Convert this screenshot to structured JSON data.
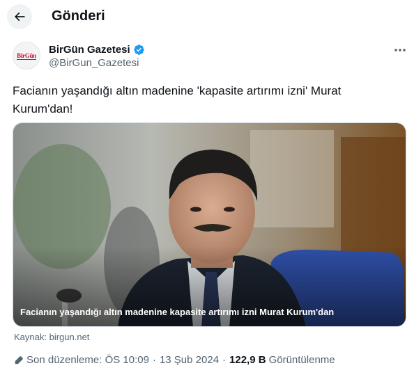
{
  "header": {
    "title": "Gönderi"
  },
  "author": {
    "avatar_text": "BirGün",
    "name": "BirGün Gazetesi",
    "handle": "@BirGun_Gazetesi"
  },
  "tweet": {
    "text": "Facianın yaşandığı altın madenine 'kapasite artırımı izni' Murat Kurum'dan!",
    "media_caption": "Facianın yaşandığı altın madenine kapasite artırımı izni Murat Kurum'dan",
    "source": "Kaynak: birgun.net"
  },
  "meta": {
    "edited": "Son düzenleme: ÖS 10:09",
    "date": "13 Şub 2024",
    "views_count": "122,9 B",
    "views_label": "Görüntülenme"
  },
  "colors": {
    "verified": "#1d9bf0",
    "secondary_text": "#536471",
    "primary_text": "#0f1419"
  }
}
